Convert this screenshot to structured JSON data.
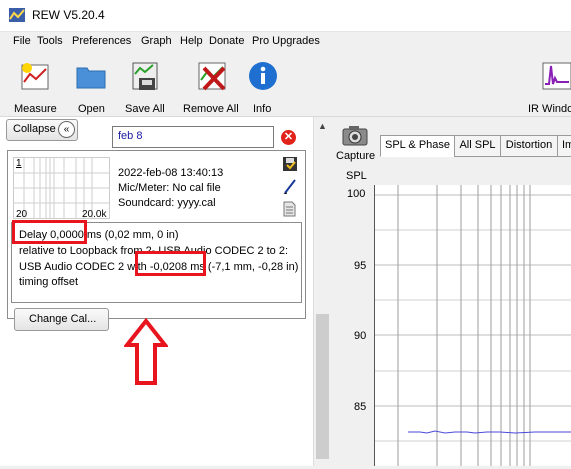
{
  "window": {
    "title": "REW V5.20.4"
  },
  "menu": [
    "File",
    "Tools",
    "Preferences",
    "Graph",
    "Help",
    "Donate",
    "Pro Upgrades"
  ],
  "toolbar": {
    "measure": "Measure",
    "open": "Open",
    "save_all": "Save All",
    "remove_all": "Remove All",
    "info": "Info",
    "ir_windows": "IR Window"
  },
  "panel": {
    "collapse": "Collapse",
    "name_value": "feb 8",
    "thumb_index": "1",
    "thumb_x_start": "20",
    "thumb_x_end": "20.0k",
    "date": "2022-feb-08 13:40:13",
    "mic_meter": "Mic/Meter: No cal file",
    "soundcard": "Soundcard: yyyy.cal",
    "notes": [
      "Delay 0,0000 ms (0,02 mm, 0 in)",
      "relative to Loopback from 2- USB Audio CODEC  2 to 2:",
      "USB Audio CODEC  2 with -0,0208 ms (-7,1 mm, -0,28 in)",
      "timing offset"
    ],
    "change_cal": "Change Cal..."
  },
  "graph": {
    "capture": "Capture",
    "tabs": [
      "SPL & Phase",
      "All SPL",
      "Distortion",
      "Im"
    ],
    "active_tab": "SPL & Phase",
    "y_axis_label": "SPL",
    "y_ticks": [
      "100",
      "95",
      "90",
      "85"
    ],
    "trace_color": "#4a4adc"
  },
  "colors": {
    "highlight": "#e8141e",
    "name_text": "#1a1aa0"
  }
}
